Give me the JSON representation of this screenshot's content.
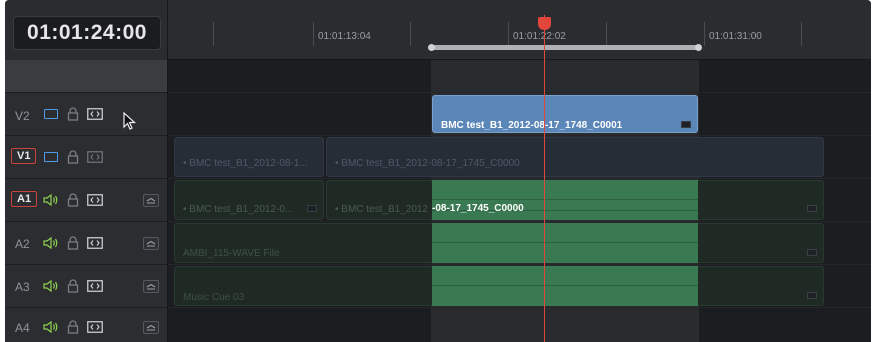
{
  "timecode": "01:01:24:00",
  "ruler": {
    "labels": [
      "01:01:13:04",
      "01:01:22:02",
      "01:01:31:00"
    ]
  },
  "tracks": [
    {
      "id": "V2",
      "type": "video",
      "highlighted": false
    },
    {
      "id": "V1",
      "type": "video",
      "highlighted": true
    },
    {
      "id": "A1",
      "type": "audio",
      "highlighted": true
    },
    {
      "id": "A2",
      "type": "audio",
      "highlighted": false
    },
    {
      "id": "A3",
      "type": "audio",
      "highlighted": false
    },
    {
      "id": "A4",
      "type": "audio",
      "highlighted": false
    }
  ],
  "clips": {
    "v2_clip": "BMC test_B1_2012-08-17_1748_C0001",
    "v1_clip_a": "• BMC test_B1_2012-08-1...",
    "v1_clip_b": "• BMC test_B1_2012-08-17_1745_C0000",
    "a1_clip_a": "• BMC test_B1_2012-0...",
    "a1_clip_b_dim": "• BMC test_B1_2012",
    "a1_clip_b_bright": "-08-17_1745_C0000",
    "a2_clip": "AMBI_115-WAVE File",
    "a3_clip": "Music Cue 03"
  },
  "colors": {
    "playhead": "#e0463c",
    "video_clip_selected": "#5b86b8",
    "audio_clip_selected": "#3a7a52",
    "video_icon": "#4f9be8",
    "audio_icon": "#8fd14f"
  },
  "icons": [
    "video-monitor-icon",
    "lock-icon",
    "auto-select-icon",
    "speaker-icon",
    "expand-icon",
    "mouse-cursor-icon",
    "playhead-icon"
  ]
}
